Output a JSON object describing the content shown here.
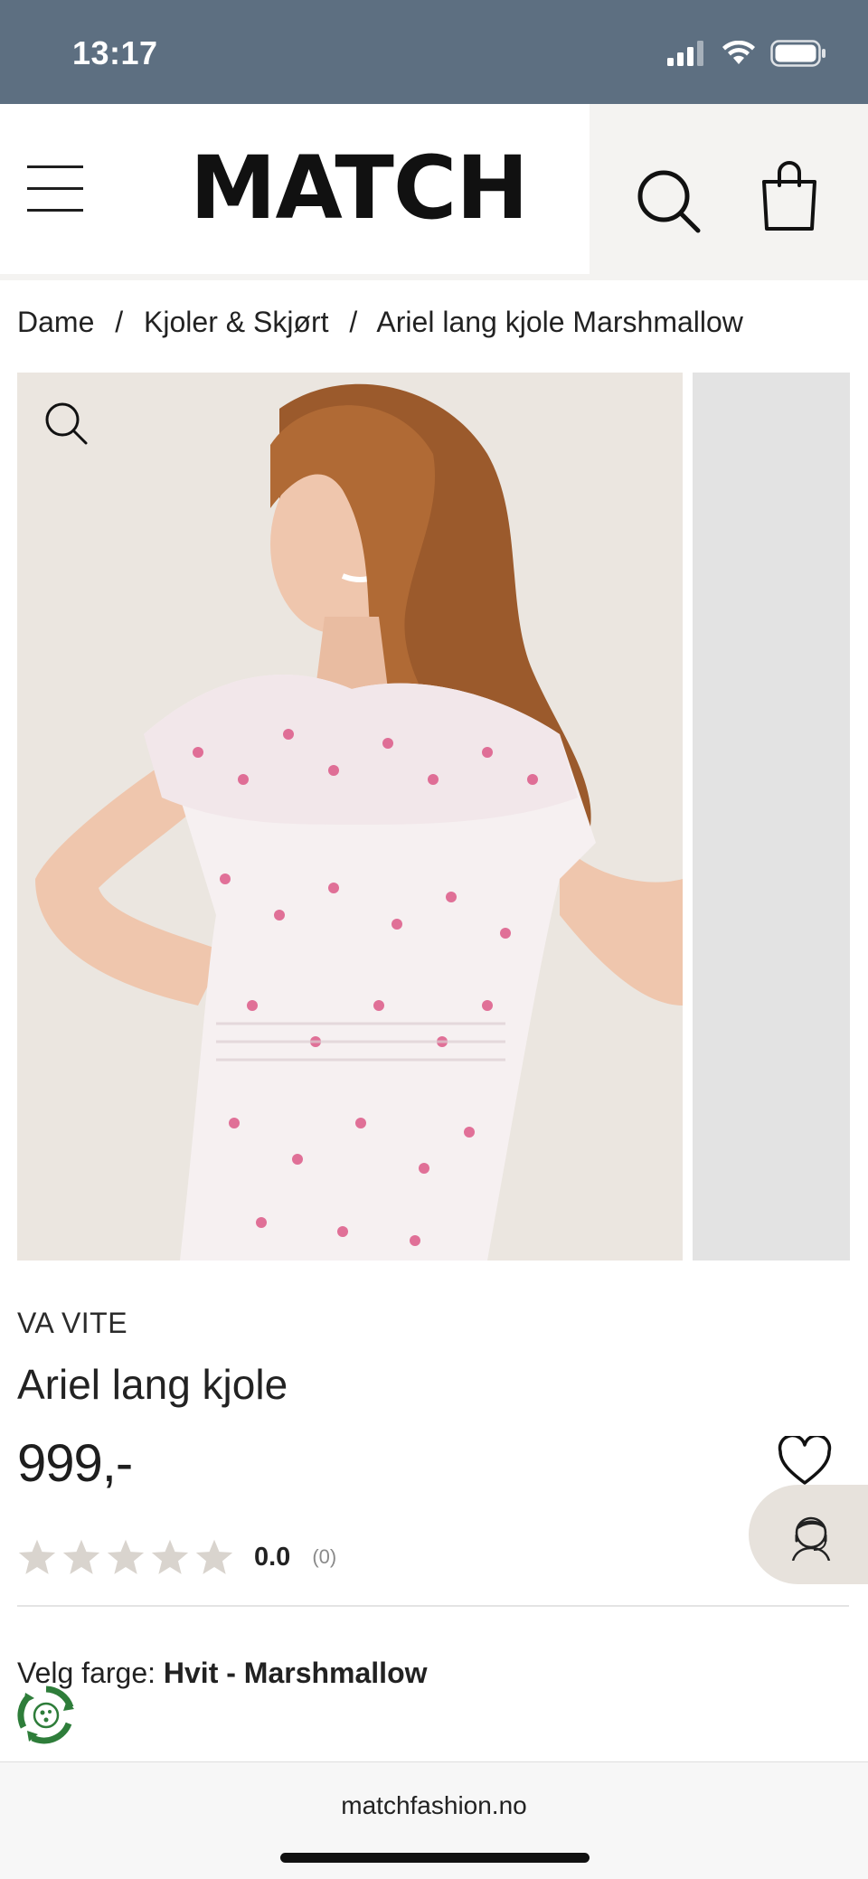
{
  "status_bar": {
    "time": "13:17",
    "icons": [
      "cellular-signal-icon",
      "wifi-icon",
      "battery-icon"
    ]
  },
  "header": {
    "logo": "MATCH",
    "icons": [
      "hamburger-menu-icon",
      "search-icon",
      "shopping-bag-icon"
    ]
  },
  "breadcrumb": {
    "items": [
      "Dame",
      "Kjoler & Skjørt",
      "Ariel lang kjole Marshmallow"
    ],
    "separator": "/"
  },
  "product": {
    "brand": "VA VITE",
    "name": "Ariel lang kjole",
    "price": "999,-",
    "rating": {
      "value": "0.0",
      "count": "(0)",
      "stars_filled": 0,
      "stars_total": 5
    },
    "color_label": "Velg farge:",
    "color_value": "Hvit - Marshmallow"
  },
  "browser": {
    "url": "matchfashion.no"
  },
  "colors": {
    "status_bar_bg": "#5d6f81",
    "header_icon_bg": "#f4f3f1",
    "star_empty": "#d9d4ce",
    "support_bg": "#e7e2dc",
    "eco_green": "#2e7d3a"
  }
}
